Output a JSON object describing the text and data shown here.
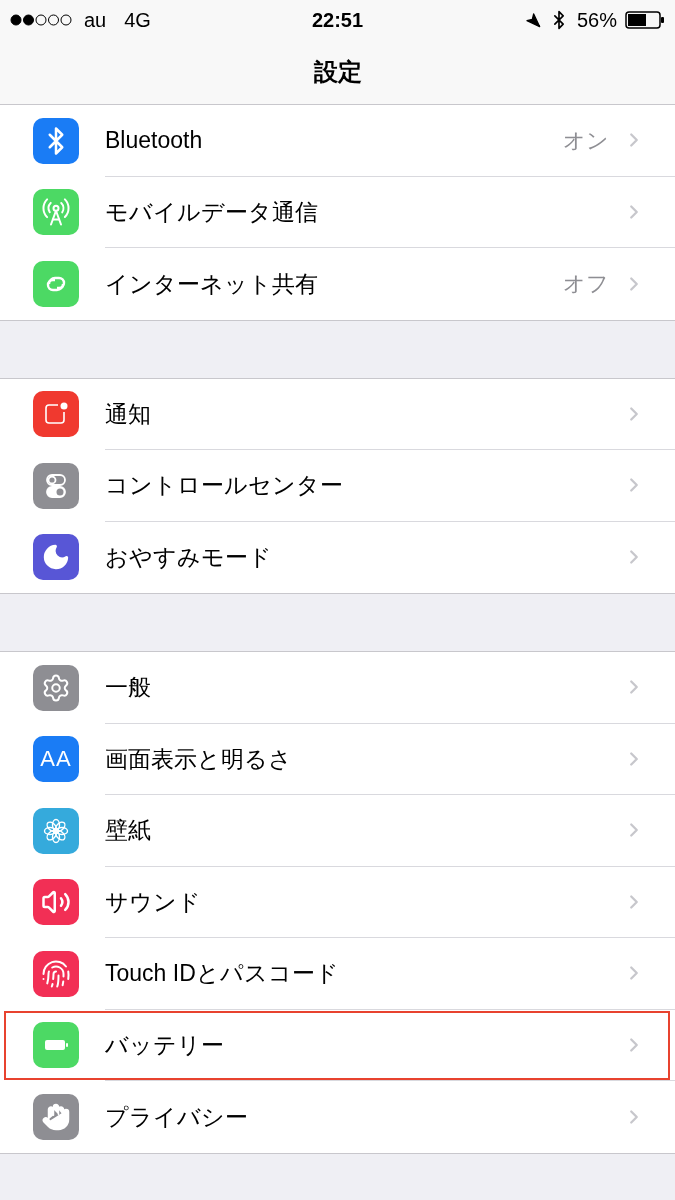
{
  "status_bar": {
    "carrier": "au",
    "network": "4G",
    "time": "22:51",
    "battery": "56%"
  },
  "nav": {
    "title": "設定"
  },
  "groups": [
    {
      "rows": [
        {
          "label": "Bluetooth",
          "value": "オン",
          "color": "#1a7cf5",
          "highlighted": false
        },
        {
          "label": "モバイルデータ通信",
          "color": "#4cd964",
          "highlighted": false
        },
        {
          "label": "インターネット共有",
          "value": "オフ",
          "color": "#4cd964",
          "highlighted": false
        }
      ]
    },
    {
      "rows": [
        {
          "label": "通知",
          "color": "#f0392f",
          "highlighted": false
        },
        {
          "label": "コントロールセンター",
          "color": "#8e8e93",
          "highlighted": false
        },
        {
          "label": "おやすみモード",
          "color": "#5856d6",
          "highlighted": false
        }
      ]
    },
    {
      "rows": [
        {
          "label": "一般",
          "color": "#8e8e93",
          "highlighted": false
        },
        {
          "label": "画面表示と明るさ",
          "color": "#1a7cf5",
          "icon_text": "AA",
          "highlighted": false
        },
        {
          "label": "壁紙",
          "color": "#35aadc",
          "highlighted": false
        },
        {
          "label": "サウンド",
          "color": "#f22f55",
          "highlighted": false
        },
        {
          "label": "Touch IDとパスコード",
          "color": "#f22f55",
          "highlighted": false
        },
        {
          "label": "バッテリー",
          "color": "#4cd964",
          "highlighted": true
        },
        {
          "label": "プライバシー",
          "color": "#8e8e93",
          "highlighted": false
        }
      ]
    }
  ]
}
